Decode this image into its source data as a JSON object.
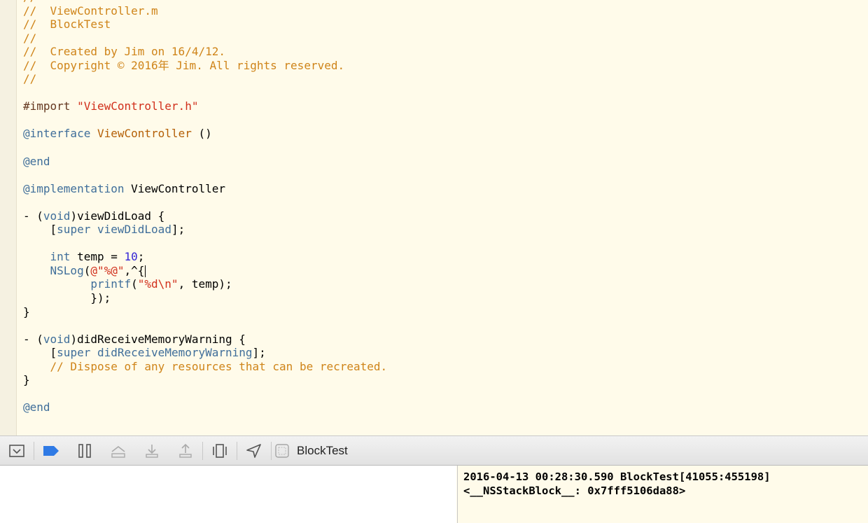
{
  "editor": {
    "lines": [
      [
        {
          "t": "//",
          "c": "comment"
        }
      ],
      [
        {
          "t": "//  ViewController.m",
          "c": "comment"
        }
      ],
      [
        {
          "t": "//  BlockTest",
          "c": "comment"
        }
      ],
      [
        {
          "t": "//",
          "c": "comment"
        }
      ],
      [
        {
          "t": "//  Created by Jim on 16/4/12.",
          "c": "comment"
        }
      ],
      [
        {
          "t": "//  Copyright © 2016年 Jim. All rights reserved.",
          "c": "comment"
        }
      ],
      [
        {
          "t": "//",
          "c": "comment"
        }
      ],
      [],
      [
        {
          "t": "#import ",
          "c": "macro"
        },
        {
          "t": "\"ViewController.h\"",
          "c": "string"
        }
      ],
      [],
      [
        {
          "t": "@interface",
          "c": "keyword"
        },
        {
          "t": " ",
          "c": "plain"
        },
        {
          "t": "ViewController",
          "c": "class"
        },
        {
          "t": " ()",
          "c": "plain"
        }
      ],
      [],
      [
        {
          "t": "@end",
          "c": "keyword"
        }
      ],
      [],
      [
        {
          "t": "@implementation",
          "c": "keyword"
        },
        {
          "t": " ViewController",
          "c": "plain"
        }
      ],
      [],
      [
        {
          "t": "- (",
          "c": "plain"
        },
        {
          "t": "void",
          "c": "keyword"
        },
        {
          "t": ")viewDidLoad {",
          "c": "plain"
        }
      ],
      [
        {
          "t": "    [",
          "c": "plain"
        },
        {
          "t": "super",
          "c": "keyword"
        },
        {
          "t": " ",
          "c": "plain"
        },
        {
          "t": "viewDidLoad",
          "c": "method"
        },
        {
          "t": "];",
          "c": "plain"
        }
      ],
      [],
      [
        {
          "t": "    ",
          "c": "plain"
        },
        {
          "t": "int",
          "c": "keyword"
        },
        {
          "t": " temp = ",
          "c": "plain"
        },
        {
          "t": "10",
          "c": "number"
        },
        {
          "t": ";",
          "c": "plain"
        }
      ],
      [
        {
          "t": "    ",
          "c": "plain"
        },
        {
          "t": "NSLog",
          "c": "method"
        },
        {
          "t": "(",
          "c": "plain"
        },
        {
          "t": "@\"%@\"",
          "c": "string"
        },
        {
          "t": ",^{",
          "c": "plain"
        },
        {
          "t": "",
          "c": "cursor"
        }
      ],
      [
        {
          "t": "          ",
          "c": "plain"
        },
        {
          "t": "printf",
          "c": "method"
        },
        {
          "t": "(",
          "c": "plain"
        },
        {
          "t": "\"%d\\n\"",
          "c": "string"
        },
        {
          "t": ", temp);",
          "c": "plain"
        }
      ],
      [
        {
          "t": "          });",
          "c": "plain"
        }
      ],
      [
        {
          "t": "}",
          "c": "plain"
        }
      ],
      [],
      [
        {
          "t": "- (",
          "c": "plain"
        },
        {
          "t": "void",
          "c": "keyword"
        },
        {
          "t": ")didReceiveMemoryWarning {",
          "c": "plain"
        }
      ],
      [
        {
          "t": "    [",
          "c": "plain"
        },
        {
          "t": "super",
          "c": "keyword"
        },
        {
          "t": " ",
          "c": "plain"
        },
        {
          "t": "didReceiveMemoryWarning",
          "c": "method"
        },
        {
          "t": "];",
          "c": "plain"
        }
      ],
      [
        {
          "t": "    // Dispose of any resources that can be recreated.",
          "c": "comment"
        }
      ],
      [
        {
          "t": "}",
          "c": "plain"
        }
      ],
      [],
      [
        {
          "t": "@end",
          "c": "keyword"
        }
      ]
    ]
  },
  "debug_bar": {
    "buttons": [
      {
        "name": "hide-debug-area-button",
        "icon": "hide-debug-area-icon"
      },
      {
        "name": "breakpoints-toggle-button",
        "icon": "breakpoint-icon"
      },
      {
        "name": "pause-continue-button",
        "icon": "pause-icon"
      },
      {
        "name": "step-over-button",
        "icon": "step-over-icon"
      },
      {
        "name": "step-into-button",
        "icon": "step-into-icon"
      },
      {
        "name": "step-out-button",
        "icon": "step-out-icon"
      },
      {
        "name": "debug-view-hierarchy-button",
        "icon": "view-hierarchy-icon"
      },
      {
        "name": "simulate-location-button",
        "icon": "location-arrow-icon"
      }
    ],
    "target_name": "BlockTest",
    "accent_color": "#2f7ae5"
  },
  "console": {
    "lines": [
      "2016-04-13 00:28:30.590 BlockTest[41055:455198]",
      "<__NSStackBlock__: 0x7fff5106da88>"
    ]
  },
  "colors": {
    "editor_background": "#fffbea",
    "comment": "#cf8419",
    "keyword": "#3f6e9a",
    "string": "#d12f1b",
    "number": "#3425d6",
    "class": "#b45f06"
  }
}
